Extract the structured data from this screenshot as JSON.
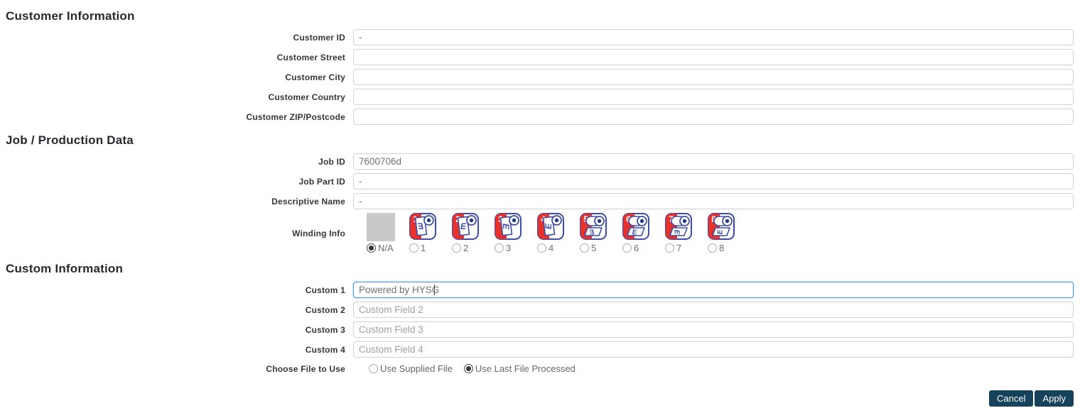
{
  "sections": {
    "customer": {
      "title": "Customer Information",
      "fields": [
        {
          "label": "Customer ID",
          "value": "-",
          "placeholder": ""
        },
        {
          "label": "Customer Street",
          "value": "",
          "placeholder": ""
        },
        {
          "label": "Customer City",
          "value": "",
          "placeholder": ""
        },
        {
          "label": "Customer Country",
          "value": "",
          "placeholder": ""
        },
        {
          "label": "Customer ZIP/Postcode",
          "value": "",
          "placeholder": ""
        }
      ]
    },
    "job": {
      "title": "Job / Production Data",
      "fields": [
        {
          "label": "Job ID",
          "value": "7600706d",
          "placeholder": ""
        },
        {
          "label": "Job Part ID",
          "value": "-",
          "placeholder": ""
        },
        {
          "label": "Descriptive Name",
          "value": "-",
          "placeholder": ""
        }
      ],
      "winding": {
        "label": "Winding Info",
        "selected": "N/A",
        "options": [
          {
            "label": "N/A",
            "icon": "na-placeholder"
          },
          {
            "label": "1",
            "icon": "winding-roll-hanging",
            "letter_orientation": "mirrored-E"
          },
          {
            "label": "2",
            "icon": "winding-roll-hanging",
            "letter_orientation": "E"
          },
          {
            "label": "3",
            "icon": "winding-roll-hanging",
            "letter_orientation": "E-rotated-cw"
          },
          {
            "label": "4",
            "icon": "winding-roll-hanging",
            "letter_orientation": "E-rotated-ccw"
          },
          {
            "label": "5",
            "icon": "winding-roll-flat",
            "letter_orientation": "mirrored-E"
          },
          {
            "label": "6",
            "icon": "winding-roll-flat",
            "letter_orientation": "E"
          },
          {
            "label": "7",
            "icon": "winding-roll-flat",
            "letter_orientation": "E-rotated-cw"
          },
          {
            "label": "8",
            "icon": "winding-roll-flat",
            "letter_orientation": "E-rotated-ccw"
          }
        ]
      }
    },
    "custom": {
      "title": "Custom Information",
      "fields": [
        {
          "label": "Custom 1",
          "value": "Powered by HYSG",
          "placeholder": "",
          "focused": true
        },
        {
          "label": "Custom 2",
          "value": "",
          "placeholder": "Custom Field 2"
        },
        {
          "label": "Custom 3",
          "value": "",
          "placeholder": "Custom Field 3"
        },
        {
          "label": "Custom 4",
          "value": "",
          "placeholder": "Custom Field 4"
        }
      ],
      "file_choice": {
        "label": "Choose File to Use",
        "selected": "Use Last File Processed",
        "options": [
          "Use Supplied File",
          "Use Last File Processed"
        ]
      }
    }
  },
  "footer": {
    "cancel_label": "Cancel",
    "apply_label": "Apply"
  },
  "colors": {
    "button_navy": "#17425c",
    "focus_blue": "#419bf9",
    "icon_red": "#e5322d",
    "icon_blue": "#3f4da3",
    "icon_dot_navy": "#1f3c8f",
    "na_gray": "#c9c9c9"
  }
}
